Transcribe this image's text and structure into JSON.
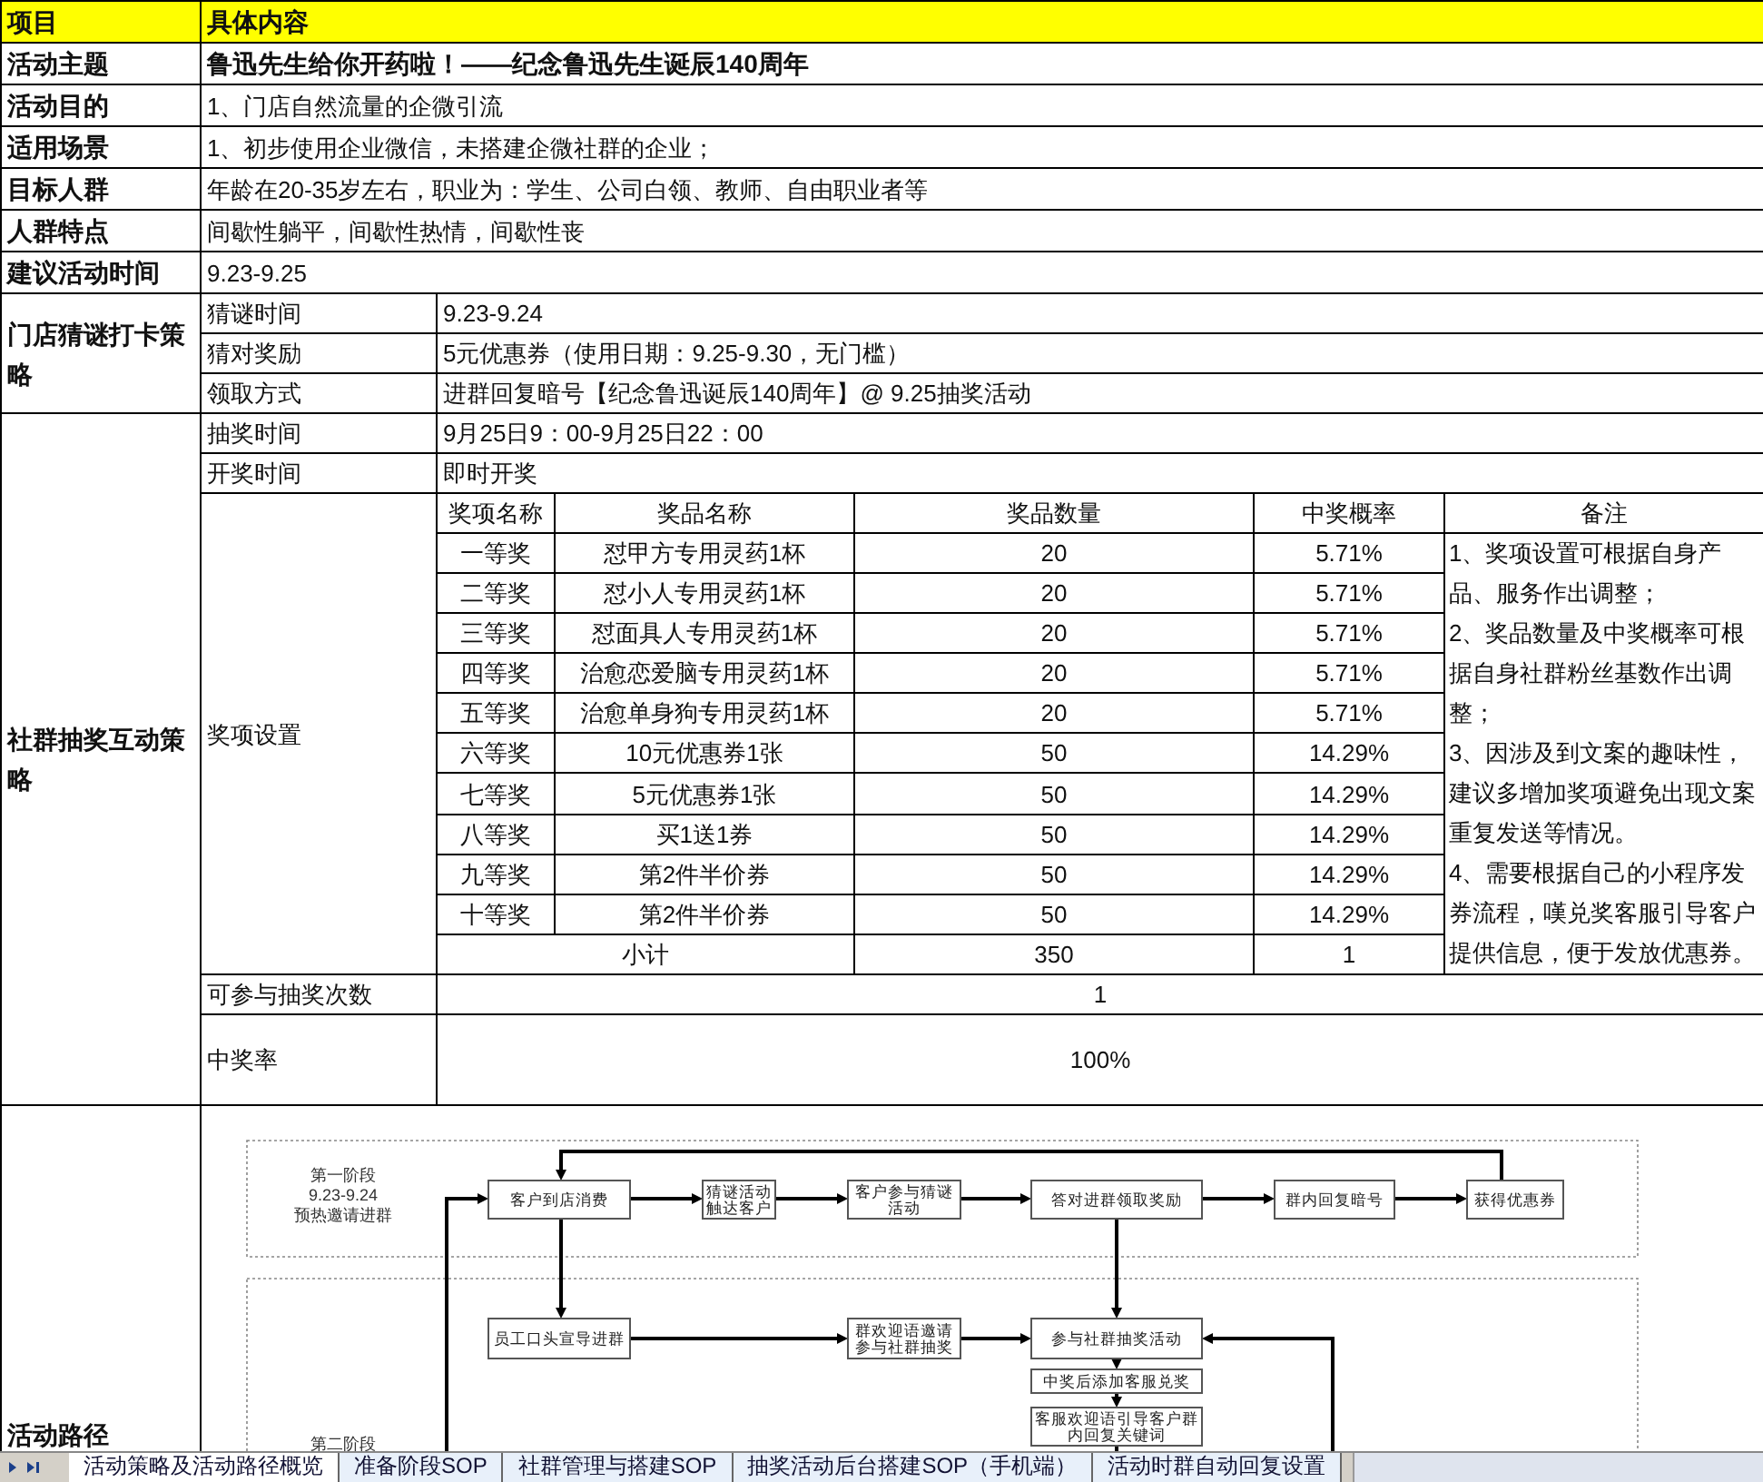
{
  "header": {
    "item": "项目",
    "content": "具体内容"
  },
  "simple_rows": [
    {
      "label": "活动主题",
      "value": "鲁迅先生给你开药啦！——纪念鲁迅先生诞辰140周年"
    },
    {
      "label": "活动目的",
      "value": "1、门店自然流量的企微引流"
    },
    {
      "label": "适用场景",
      "value": "1、初步使用企业微信，未搭建企微社群的企业；"
    },
    {
      "label": "目标人群",
      "value": "年龄在20-35岁左右，职业为：学生、公司白领、教师、自由职业者等"
    },
    {
      "label": "人群特点",
      "value": "间歇性躺平，间歇性热情，间歇性丧"
    },
    {
      "label": "建议活动时间",
      "value": "9.23-9.25"
    }
  ],
  "guess_strategy": {
    "label": "门店猜谜打卡策略",
    "rows": [
      {
        "label": "猜谜时间",
        "value": "9.23-9.24"
      },
      {
        "label": "猜对奖励",
        "value": "5元优惠券（使用日期：9.25-9.30，无门槛）"
      },
      {
        "label": "领取方式",
        "value": "进群回复暗号【纪念鲁迅诞辰140周年】@ 9.25抽奖活动"
      }
    ]
  },
  "lottery_strategy": {
    "label": "社群抽奖互动策略",
    "rows": [
      {
        "label": "抽奖时间",
        "value": "9月25日9：00-9月25日22：00"
      },
      {
        "label": "开奖时间",
        "value": "即时开奖"
      }
    ],
    "prize_setting_label": "奖项设置",
    "prize_table": {
      "columns": [
        "奖项名称",
        "奖品名称",
        "奖品数量",
        "中奖概率",
        "备注"
      ],
      "rows": [
        {
          "level": "一等奖",
          "prize": "怼甲方专用灵药1杯",
          "quantity": "20",
          "probability": "5.71%"
        },
        {
          "level": "二等奖",
          "prize": "怼小人专用灵药1杯",
          "quantity": "20",
          "probability": "5.71%"
        },
        {
          "level": "三等奖",
          "prize": "怼面具人专用灵药1杯",
          "quantity": "20",
          "probability": "5.71%"
        },
        {
          "level": "四等奖",
          "prize": "治愈恋爱脑专用灵药1杯",
          "quantity": "20",
          "probability": "5.71%"
        },
        {
          "level": "五等奖",
          "prize": "治愈单身狗专用灵药1杯",
          "quantity": "20",
          "probability": "5.71%"
        },
        {
          "level": "六等奖",
          "prize": "10元优惠券1张",
          "quantity": "50",
          "probability": "14.29%"
        },
        {
          "level": "七等奖",
          "prize": "5元优惠券1张",
          "quantity": "50",
          "probability": "14.29%"
        },
        {
          "level": "八等奖",
          "prize": "买1送1券",
          "quantity": "50",
          "probability": "14.29%"
        },
        {
          "level": "九等奖",
          "prize": "第2件半价券",
          "quantity": "50",
          "probability": "14.29%"
        },
        {
          "level": "十等奖",
          "prize": "第2件半价券",
          "quantity": "50",
          "probability": "14.29%"
        }
      ],
      "subtotal": {
        "label": "小计",
        "quantity": "350",
        "probability": "1"
      },
      "note": [
        "1、奖项设置可根据自身产品、服务作出调整；",
        "2、奖品数量及中奖概率可根据自身社群粉丝基数作出调整；",
        "3、因涉及到文案的趣味性，建议多增加奖项避免出现文案重复发送等情况。",
        "4、需要根据自己的小程序发券流程，嘆兑奖客服引导客户提供信息，便于发放优惠券。"
      ]
    },
    "extra_rows": [
      {
        "label": "可参与抽奖次数",
        "value": "1"
      },
      {
        "label": "中奖率",
        "value": "100%"
      }
    ]
  },
  "activity_path": {
    "label": "活动路径",
    "stages": [
      {
        "lines": [
          "第一阶段",
          "9.23-9.24",
          "预热邀请进群"
        ]
      },
      {
        "lines": [
          "第二阶段"
        ]
      }
    ],
    "nodes": [
      {
        "lines": [
          "客户到店消费"
        ]
      },
      {
        "lines": [
          "猜谜活动",
          "触达客户"
        ]
      },
      {
        "lines": [
          "客户参与猜谜",
          "活动"
        ]
      },
      {
        "lines": [
          "答对进群领取奖励"
        ]
      },
      {
        "lines": [
          "群内回复暗号"
        ]
      },
      {
        "lines": [
          "获得优惠券"
        ]
      },
      {
        "lines": [
          "员工口头宣导进群"
        ]
      },
      {
        "lines": [
          "群欢迎语邀请",
          "参与社群抽奖"
        ]
      },
      {
        "lines": [
          "参与社群抽奖活动"
        ]
      },
      {
        "lines": [
          "中奖后添加客服兑奖"
        ]
      },
      {
        "lines": [
          "客服欢迎语引导客户群",
          "内回复关键词"
        ]
      }
    ]
  },
  "sheet_tabs": [
    {
      "label": "活动策略及活动路径概览",
      "selected": true
    },
    {
      "label": "准备阶段SOP",
      "selected": false
    },
    {
      "label": "社群管理与搭建SOP",
      "selected": false
    },
    {
      "label": "抽奖活动后台搭建SOP（手机端）",
      "selected": false
    },
    {
      "label": "活动时群自动回复设置",
      "selected": false
    }
  ]
}
